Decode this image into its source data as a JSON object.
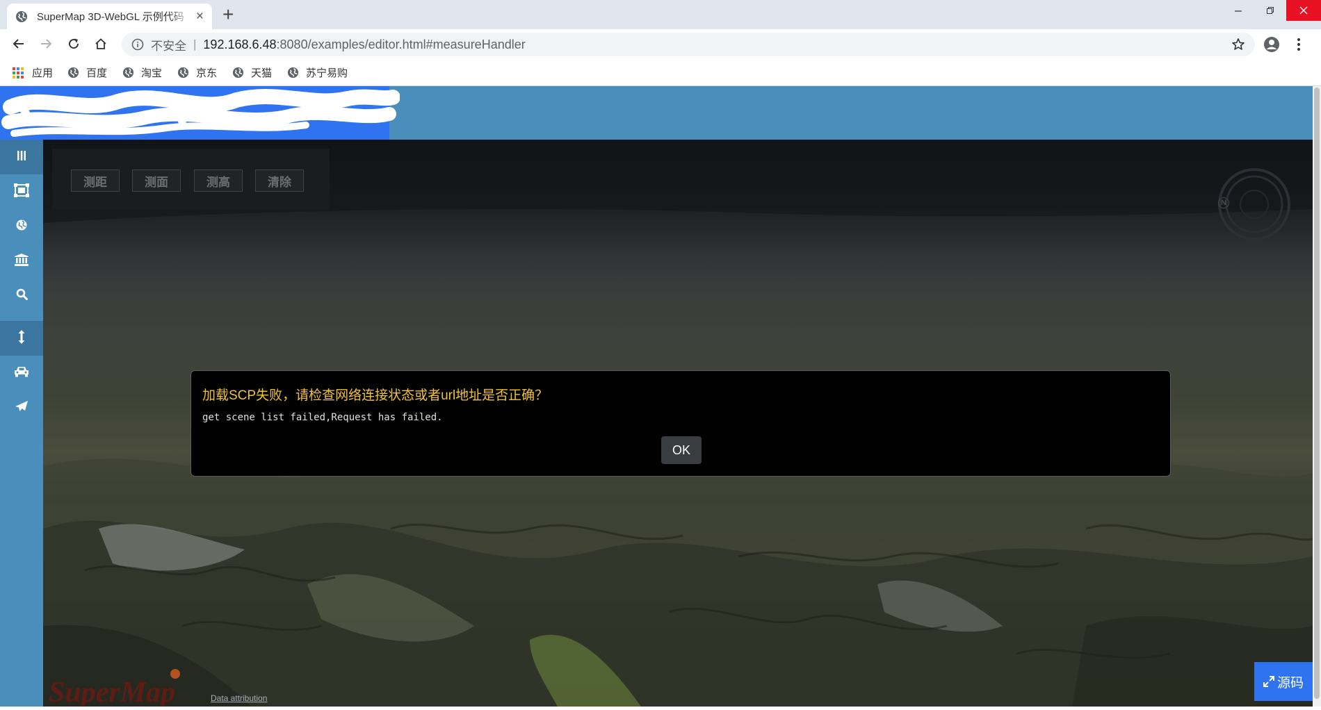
{
  "browser": {
    "tab": {
      "title": "SuperMap 3D-WebGL 示例代码",
      "close": "×"
    },
    "new_tab": "+",
    "window": {
      "minimize": "—",
      "maximize": "❐",
      "close": "✕"
    },
    "address": {
      "security_label": "不安全",
      "separator": "|",
      "host": "192.168.6.48",
      "path": ":8080/examples/editor.html#measureHandler"
    },
    "bookmarks": [
      {
        "label": "应用",
        "icon": "apps-grid-icon"
      },
      {
        "label": "百度",
        "icon": "globe-icon"
      },
      {
        "label": "淘宝",
        "icon": "globe-icon"
      },
      {
        "label": "京东",
        "icon": "globe-icon"
      },
      {
        "label": "天猫",
        "icon": "globe-icon"
      },
      {
        "label": "苏宁易购",
        "icon": "globe-icon"
      }
    ]
  },
  "sidebar": {
    "items": [
      {
        "icon": "menu-bars-icon"
      },
      {
        "icon": "layers-icon"
      },
      {
        "icon": "globe-icon"
      },
      {
        "icon": "bank-icon"
      },
      {
        "icon": "search-icon"
      },
      {
        "icon": "vertical-arrows-icon",
        "active": true
      },
      {
        "icon": "car-icon"
      },
      {
        "icon": "paper-plane-icon"
      }
    ]
  },
  "measure_panel": {
    "buttons": [
      "测距",
      "测面",
      "测高",
      "清除"
    ]
  },
  "compass": {
    "label": "N"
  },
  "dialog": {
    "title": "加载SCP失败，请检查网络连接状态或者url地址是否正确？",
    "message": "get scene list failed,Request has failed.",
    "ok_label": "OK"
  },
  "footer": {
    "brand": "SuperMap",
    "attribution": "Data attribution"
  },
  "source_button": {
    "label": "源码"
  },
  "colors": {
    "header_bg": "#4a8ebc",
    "logo_bg": "#2f73f0",
    "dialog_title": "#f2c230",
    "close_button": "#e81123"
  }
}
